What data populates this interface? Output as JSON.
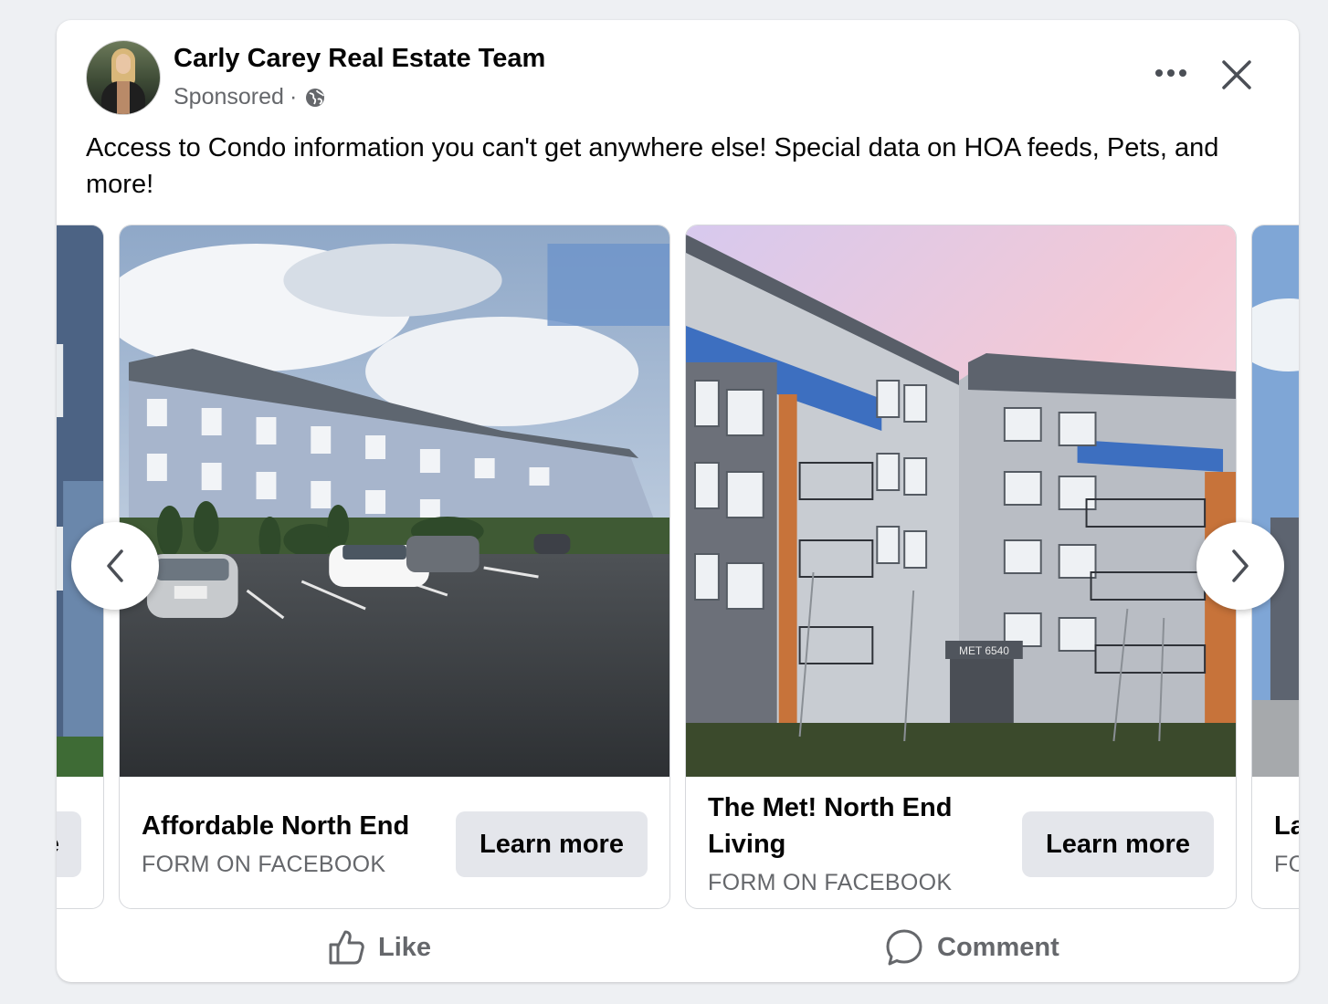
{
  "post": {
    "page_name": "Carly Carey Real Estate Team",
    "sponsored_label": "Sponsored",
    "separator": "·",
    "body_text": "Access to Condo information you can't get anywhere else! Special data on HOA feeds, Pets, and more!"
  },
  "carousel": {
    "cards": [
      {
        "headline": "Affordable North End",
        "subline": "FORM ON FACEBOOK",
        "cta_label": "Learn more",
        "image": "photo of blue-grey condo complex with parking lot"
      },
      {
        "headline": "The Met! North End Living",
        "subline": "FORM ON FACEBOOK",
        "cta_label": "Learn more",
        "image": "photo of modern grey apartment building with blue and orange accents"
      }
    ],
    "partial_left": {
      "cta_fragment": "e"
    },
    "partial_right": {
      "headline_fragment": "La",
      "subline_fragment": "FC"
    }
  },
  "actions": {
    "like_label": "Like",
    "comment_label": "Comment"
  },
  "colors": {
    "background": "#eef0f3",
    "card": "#ffffff",
    "secondary_text": "#65676b",
    "button_bg": "#e4e6eb"
  },
  "icons": [
    "avatar",
    "globe-icon",
    "more-options-icon",
    "close-icon",
    "chevron-left-icon",
    "chevron-right-icon",
    "thumbs-up-icon",
    "comment-icon"
  ]
}
